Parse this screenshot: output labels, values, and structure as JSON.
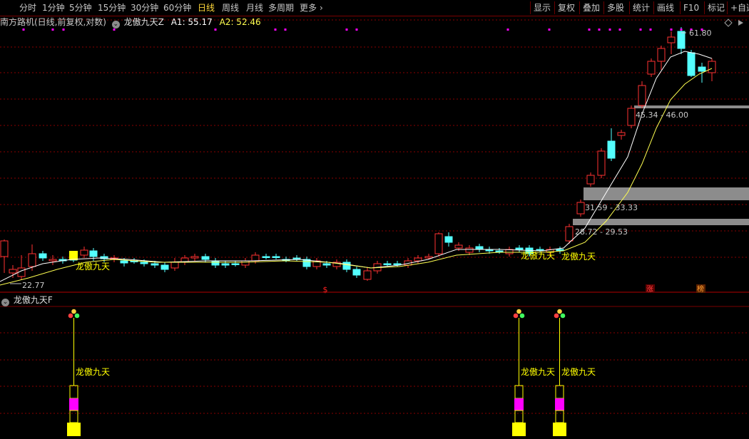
{
  "toolbar": {
    "periods": [
      "分时",
      "1分钟",
      "5分钟",
      "15分钟",
      "30分钟",
      "60分钟",
      "日线",
      "周线",
      "月线",
      "多周期",
      "更多"
    ],
    "active_period": "日线",
    "more_arrow": "›",
    "right_buttons": [
      "显示",
      "复权",
      "叠加",
      "多股",
      "统计",
      "画线",
      "F10",
      "标记",
      "+自选"
    ]
  },
  "main": {
    "stock_label": "南方路机(日线,前复权,对数)",
    "indicator_name": "龙傲九天Z",
    "a1_label": "A1: 55.17",
    "a2_label": "A2: 52.46",
    "price_high": "61.80",
    "price_low": "22.77",
    "zones": [
      "45.34 - 46.00",
      "31.59 - 33.33",
      "28.72 - 29.53"
    ],
    "signal_text": "龙傲九天",
    "badge_zhang": "涨",
    "badge_bang": "榜",
    "badge_s": "$"
  },
  "sub": {
    "indicator_name": "龙傲九天F",
    "signal_text": "龙傲九天"
  },
  "colors": {
    "bg": "#000000",
    "up": "#ff3232",
    "down": "#54ffff",
    "ma_white": "#ffffff",
    "ma_yellow": "#ffff50",
    "zone": "#8c8c8c",
    "magenta": "#ff00ff",
    "signal_yellow": "#ffff00",
    "grid": "#8a0000"
  }
}
